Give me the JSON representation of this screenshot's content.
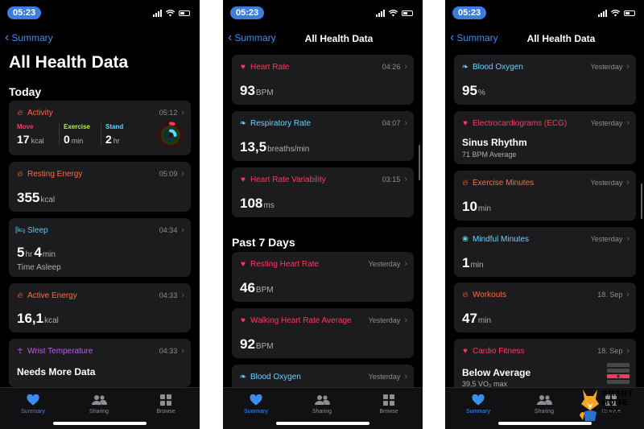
{
  "status_time": "05:23",
  "nav": {
    "back_label": "Summary",
    "title": "All Health Data"
  },
  "colors": {
    "heart": "#ff375f",
    "flame": "#ff6b3d",
    "blue": "#64d2ff",
    "purple": "#bf5af2",
    "teal": "#5ac8fa",
    "accent": "#3b8ef0"
  },
  "tabs": [
    {
      "label": "Summary",
      "icon": "heart-icon"
    },
    {
      "label": "Sharing",
      "icon": "people-icon"
    },
    {
      "label": "Browse",
      "icon": "grid-icon"
    }
  ],
  "screen1": {
    "big_title": "All Health Data",
    "section_today": "Today",
    "activity": {
      "title": "Activity",
      "time": "05:12",
      "move_label": "Move",
      "move_value": "17",
      "move_unit": "kcal",
      "exercise_label": "Exercise",
      "exercise_value": "0",
      "exercise_unit": "min",
      "stand_label": "Stand",
      "stand_value": "2",
      "stand_unit": "hr"
    },
    "resting_energy": {
      "title": "Resting Energy",
      "time": "05:09",
      "value": "355",
      "unit": "kcal"
    },
    "sleep": {
      "title": "Sleep",
      "time": "04:34",
      "hours": "5",
      "hours_unit": "hr",
      "minutes": "4",
      "minutes_unit": "min",
      "sub": "Time Asleep"
    },
    "active_energy": {
      "title": "Active Energy",
      "time": "04:33",
      "value": "16,1",
      "unit": "kcal"
    },
    "wrist_temp": {
      "title": "Wrist Temperature",
      "time": "04:33",
      "value": "Needs More Data"
    }
  },
  "screen2": {
    "heart_rate": {
      "title": "Heart Rate",
      "time": "04:26",
      "value": "93",
      "unit": "BPM"
    },
    "respiratory_rate": {
      "title": "Respiratory Rate",
      "time": "04:07",
      "value": "13,5",
      "unit": "breaths/min"
    },
    "hrv": {
      "title": "Heart Rate Variability",
      "time": "03:15",
      "value": "108",
      "unit": "ms"
    },
    "section_past7": "Past 7 Days",
    "resting_hr": {
      "title": "Resting Heart Rate",
      "time": "Yesterday",
      "value": "46",
      "unit": "BPM"
    },
    "walking_hr": {
      "title": "Walking Heart Rate Average",
      "time": "Yesterday",
      "value": "92",
      "unit": "BPM"
    },
    "blood_oxygen": {
      "title": "Blood Oxygen",
      "time": "Yesterday"
    }
  },
  "screen3": {
    "blood_oxygen": {
      "title": "Blood Oxygen",
      "time": "Yesterday",
      "value": "95",
      "unit": "%"
    },
    "ecg": {
      "title": "Electrocardiograms (ECG)",
      "time": "Yesterday",
      "value": "Sinus Rhythm",
      "sub": "71 BPM Average"
    },
    "exercise_minutes": {
      "title": "Exercise Minutes",
      "time": "Yesterday",
      "value": "10",
      "unit": "min"
    },
    "mindful_minutes": {
      "title": "Mindful Minutes",
      "time": "Yesterday",
      "value": "1",
      "unit": "min"
    },
    "workouts": {
      "title": "Workouts",
      "time": "18. Sep",
      "value": "47",
      "unit": "min"
    },
    "cardio_fitness": {
      "title": "Cardio Fitness",
      "time": "18. Sep",
      "value": "Below Average",
      "sub": "39,5 VO₂ max"
    }
  },
  "watermark": {
    "line1": "SMART",
    "line2": "HOME",
    "line3": "FOX"
  }
}
